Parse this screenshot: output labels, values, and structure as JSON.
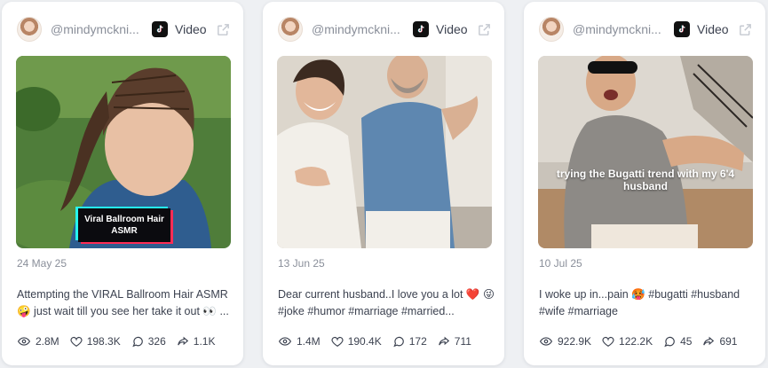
{
  "cards": [
    {
      "handle": "@mindymckni...",
      "platform": "Video",
      "overlay": "Viral Ballroom Hair ASMR",
      "date": "24 May 25",
      "caption": "Attempting the VIRAL Ballroom Hair ASMR 🤪 just wait till you see her take it out 👀 ...",
      "views": "2.8M",
      "likes": "198.3K",
      "comments": "326",
      "shares": "1.1K"
    },
    {
      "handle": "@mindymckni...",
      "platform": "Video",
      "overlay": "",
      "date": "13 Jun 25",
      "caption": "Dear current husband..I love you a lot ❤️ 😜 #joke #humor #marriage #married...",
      "views": "1.4M",
      "likes": "190.4K",
      "comments": "172",
      "shares": "711"
    },
    {
      "handle": "@mindymckni...",
      "platform": "Video",
      "overlay": "trying the Bugatti trend with my 6'4 husband",
      "date": "10 Jul 25",
      "caption": "I woke up in...pain 🥵 #bugatti #husband #wife #marriage",
      "views": "922.9K",
      "likes": "122.2K",
      "comments": "45",
      "shares": "691"
    }
  ],
  "icons": {
    "platform": "tiktok-icon",
    "open": "external-link-icon",
    "views": "eye-icon",
    "likes": "heart-icon",
    "comments": "comment-icon",
    "shares": "share-icon"
  },
  "colors": {
    "text": "#3c4250",
    "muted": "#8a8f9a",
    "card": "#ffffff",
    "background": "#eef0f3"
  }
}
